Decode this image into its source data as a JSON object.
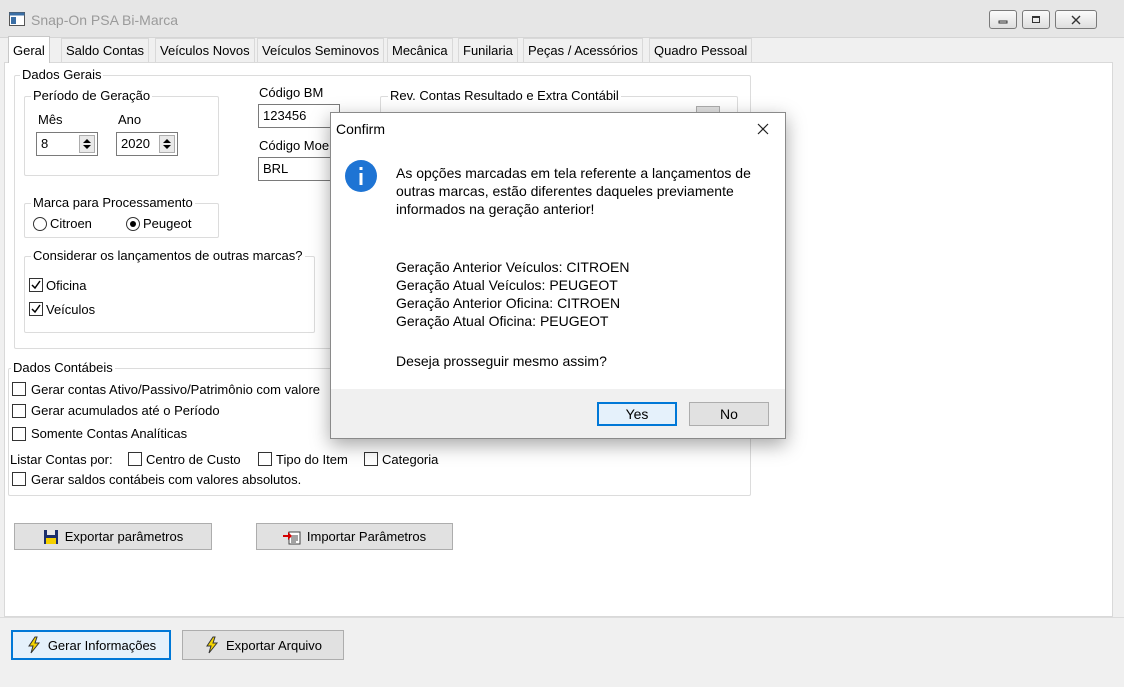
{
  "window": {
    "title": "Snap-On PSA Bi-Marca"
  },
  "tabs": [
    {
      "label": "Geral"
    },
    {
      "label": "Saldo Contas"
    },
    {
      "label": "Veículos Novos"
    },
    {
      "label": "Veículos Seminovos"
    },
    {
      "label": "Mecânica"
    },
    {
      "label": "Funilaria"
    },
    {
      "label": "Peças / Acessórios"
    },
    {
      "label": "Quadro Pessoal"
    }
  ],
  "dados_gerais": {
    "legend": "Dados Gerais",
    "periodo": {
      "legend": "Período de Geração",
      "mes_label": "Mês",
      "mes_value": "8",
      "ano_label": "Ano",
      "ano_value": "2020"
    },
    "codigo_bm": {
      "label": "Código BM",
      "value": "123456"
    },
    "codigo_moeda": {
      "label": "Código Moe",
      "value": "BRL"
    },
    "rev_contas": {
      "legend": "Rev. Contas Resultado e Extra Contábil"
    },
    "marca": {
      "legend": "Marca para Processamento",
      "options": [
        "Citroen",
        "Peugeot"
      ],
      "selected": "Peugeot"
    },
    "outras_marcas": {
      "legend": "Considerar os lançamentos de outras marcas?",
      "oficina_label": "Oficina",
      "veiculos_label": "Veículos"
    }
  },
  "dados_contabeis": {
    "legend": "Dados Contábeis",
    "gerar_contas_label": "Gerar contas Ativo/Passivo/Patrimônio com valore",
    "gerar_acumulados_label": "Gerar acumulados até o Período",
    "somente_analiticas_label": "Somente Contas Analíticas",
    "listar_por_label": "Listar Contas por:",
    "centro_custo_label": "Centro de Custo",
    "tipo_item_label": "Tipo do Item",
    "categoria_label": "Categoria",
    "saldos_absolutos_label": "Gerar saldos contábeis com valores absolutos."
  },
  "buttons": {
    "exportar_parametros": "Exportar parâmetros",
    "importar_parametros": "Importar Parâmetros",
    "gerar_informacoes": "Gerar Informações",
    "exportar_arquivo": "Exportar Arquivo"
  },
  "dialog": {
    "title": "Confirm",
    "message_line1": "As opções marcadas em tela referente a lançamentos de",
    "message_line2": "outras marcas, estão diferentes daqueles previamente",
    "message_line3": "informados na geração anterior!",
    "detail_line1": "Geração Anterior Veículos: CITROEN",
    "detail_line2": "Geração Atual Veículos: PEUGEOT",
    "detail_line3": "Geração Anterior Oficina: CITROEN",
    "detail_line4": "Geração Atual Oficina: PEUGEOT",
    "question": "Deseja prosseguir mesmo assim?",
    "yes_label": "Yes",
    "no_label": "No"
  },
  "icons": {
    "app": "app-window-icon",
    "info": "info-icon",
    "export": "floppy-disk-icon",
    "import": "import-icon",
    "generate": "lightning-icon",
    "close": "close-icon"
  },
  "colors": {
    "info_blue": "#1e74d4",
    "default_button_border": "#0078d7",
    "lightning_yellow": "#f5d400"
  }
}
